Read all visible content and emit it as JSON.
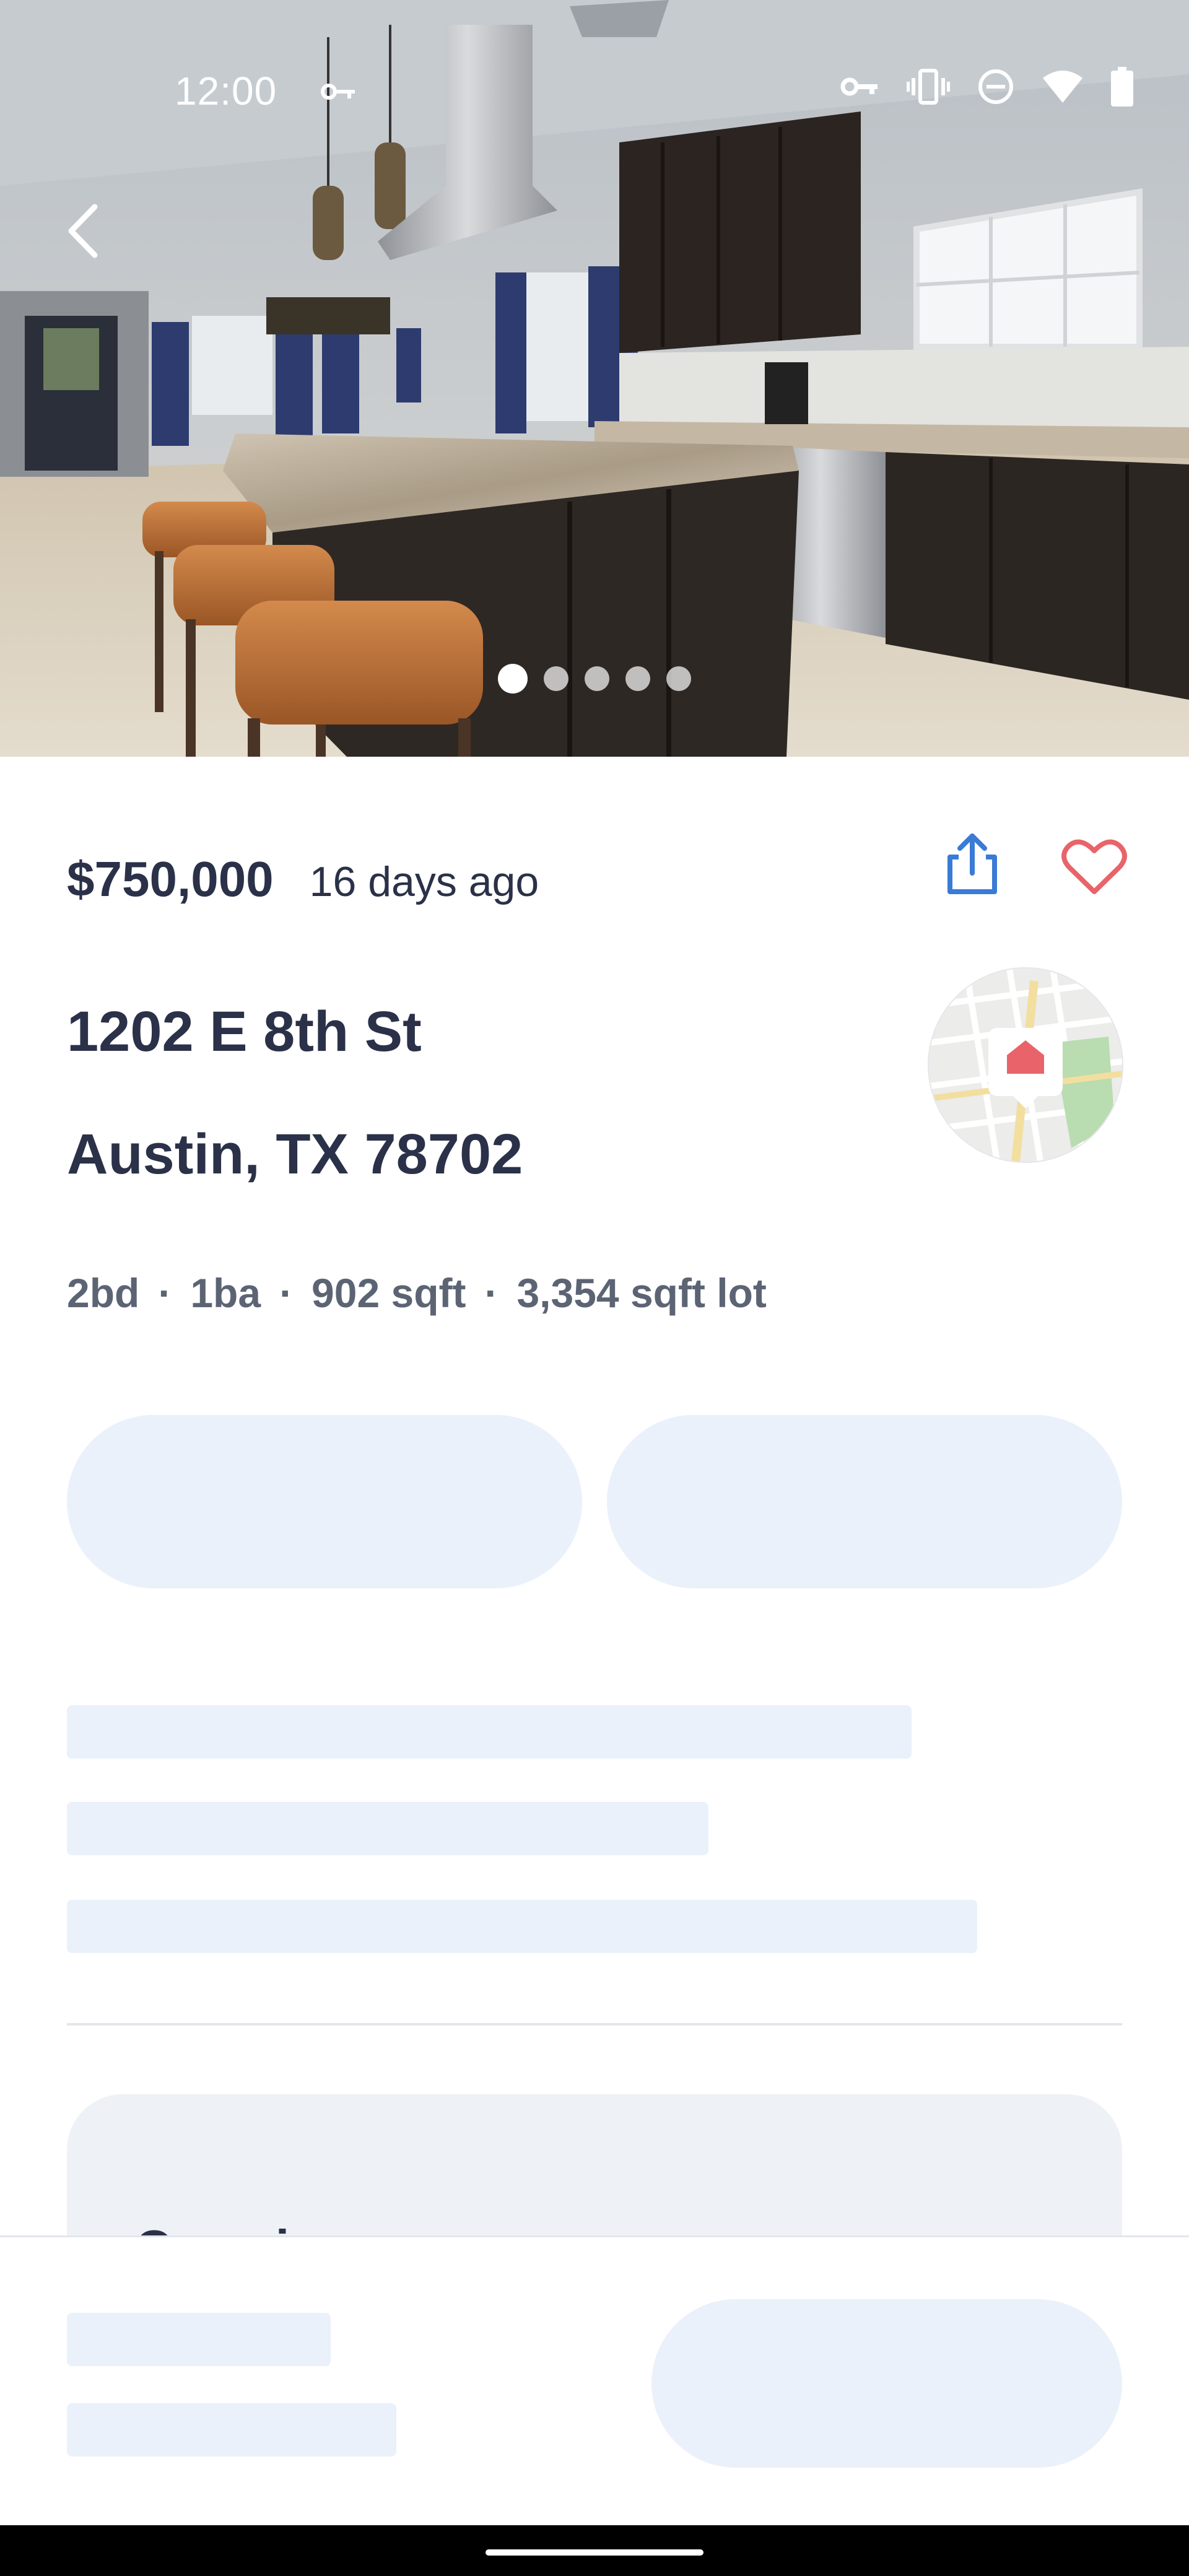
{
  "status_bar": {
    "time": "12:00",
    "icons": [
      "vpn-key-icon",
      "vibrate-icon",
      "do-not-disturb-icon",
      "wifi-icon",
      "battery-icon"
    ]
  },
  "gallery": {
    "photo_count": 5,
    "active_index": 0
  },
  "listing": {
    "price": "$750,000",
    "listed_ago": "16 days ago",
    "address_line1": "1202 E 8th St",
    "address_line2": "Austin, TX 78702",
    "beds": "2bd",
    "baths": "1ba",
    "sqft": "902 sqft",
    "lot": "3,354 sqft lot",
    "separator": "·"
  },
  "overview_card": {
    "title": "Overview"
  },
  "colors": {
    "text_primary": "#2a3148",
    "text_secondary": "#5c6474",
    "accent_blue": "#3a7bd5",
    "favorite_red": "#e8646a",
    "skeleton": "#eaf1fb"
  }
}
